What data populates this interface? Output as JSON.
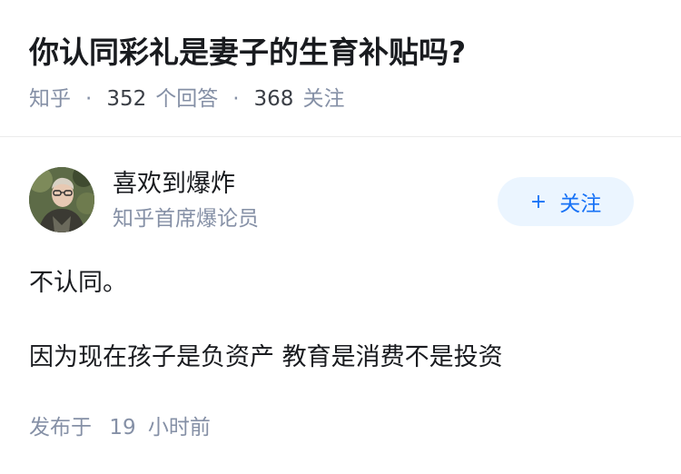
{
  "question": {
    "title": "你认同彩礼是妻子的生育补贴吗?",
    "source": "知乎",
    "answer_count": "352",
    "answer_label": "个回答",
    "follower_count": "368",
    "follower_label": "关注"
  },
  "author": {
    "name": "喜欢到爆炸",
    "bio": "知乎首席爆论员",
    "follow_label": "关注",
    "follow_icon": "plus-icon",
    "avatar": "avatar-photo"
  },
  "answer": {
    "paragraphs": [
      "不认同。",
      "因为现在孩子是负资产 教育是消费不是投资"
    ]
  },
  "footer": {
    "published_prefix": "发布于",
    "published_num": "19",
    "published_suffix": "小时前"
  },
  "colors": {
    "accent": "#1772f6",
    "follow_bg": "#ebf5ff",
    "meta_text": "#8590a6",
    "title_text": "#191b1f"
  }
}
